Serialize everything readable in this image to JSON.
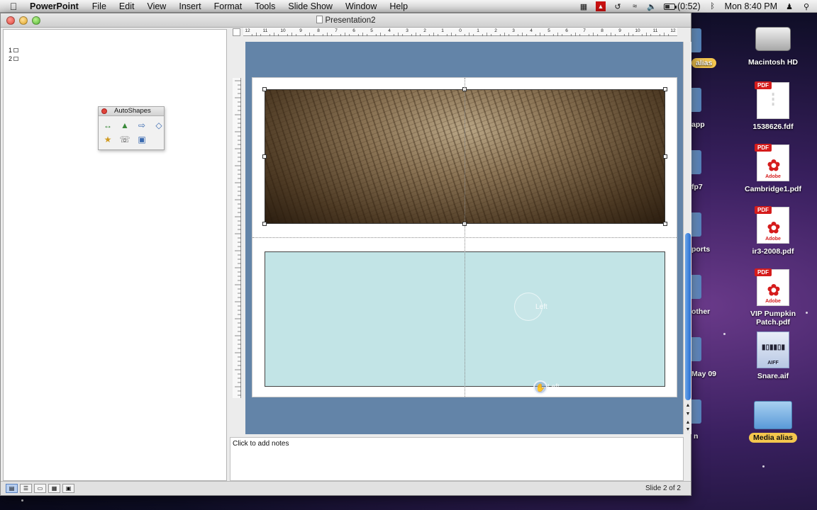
{
  "menubar": {
    "app_name": "PowerPoint",
    "menus": [
      "File",
      "Edit",
      "View",
      "Insert",
      "Format",
      "Tools",
      "Slide Show",
      "Window",
      "Help"
    ],
    "battery": "(0:52)",
    "clock": "Mon 8:40 PM"
  },
  "window": {
    "title": "Presentation2"
  },
  "outline": {
    "slides": [
      "1",
      "2"
    ]
  },
  "palette": {
    "title": "AutoShapes"
  },
  "ruler": {
    "ticks": [
      "12",
      "11",
      "10",
      "9",
      "8",
      "7",
      "6",
      "5",
      "4",
      "3",
      "2",
      "1",
      "0",
      "1",
      "2",
      "3",
      "4",
      "5",
      "6",
      "7",
      "8",
      "9",
      "10",
      "11",
      "12"
    ]
  },
  "slide": {
    "ghost_label_1": "Left",
    "ghost_label_2": "Left"
  },
  "notes": {
    "placeholder": "Click to add notes"
  },
  "status": {
    "slide_count": "Slide 2 of 2"
  },
  "desktop": {
    "items": [
      {
        "label": "Macintosh HD"
      },
      {
        "label": "1538626.fdf"
      },
      {
        "label": "Cambridge1.pdf"
      },
      {
        "label": "ir3-2008.pdf"
      },
      {
        "label": "VIP Pumpkin Patch.pdf"
      },
      {
        "label": "Snare.aif"
      },
      {
        "label": "Media alias"
      }
    ],
    "pdf_tag": "PDF",
    "adobe": "Adobe",
    "aiff": "AIFF",
    "partial_labels": [
      "alias",
      "app",
      "fp7",
      "ports",
      "other",
      "May 09",
      "n"
    ]
  }
}
